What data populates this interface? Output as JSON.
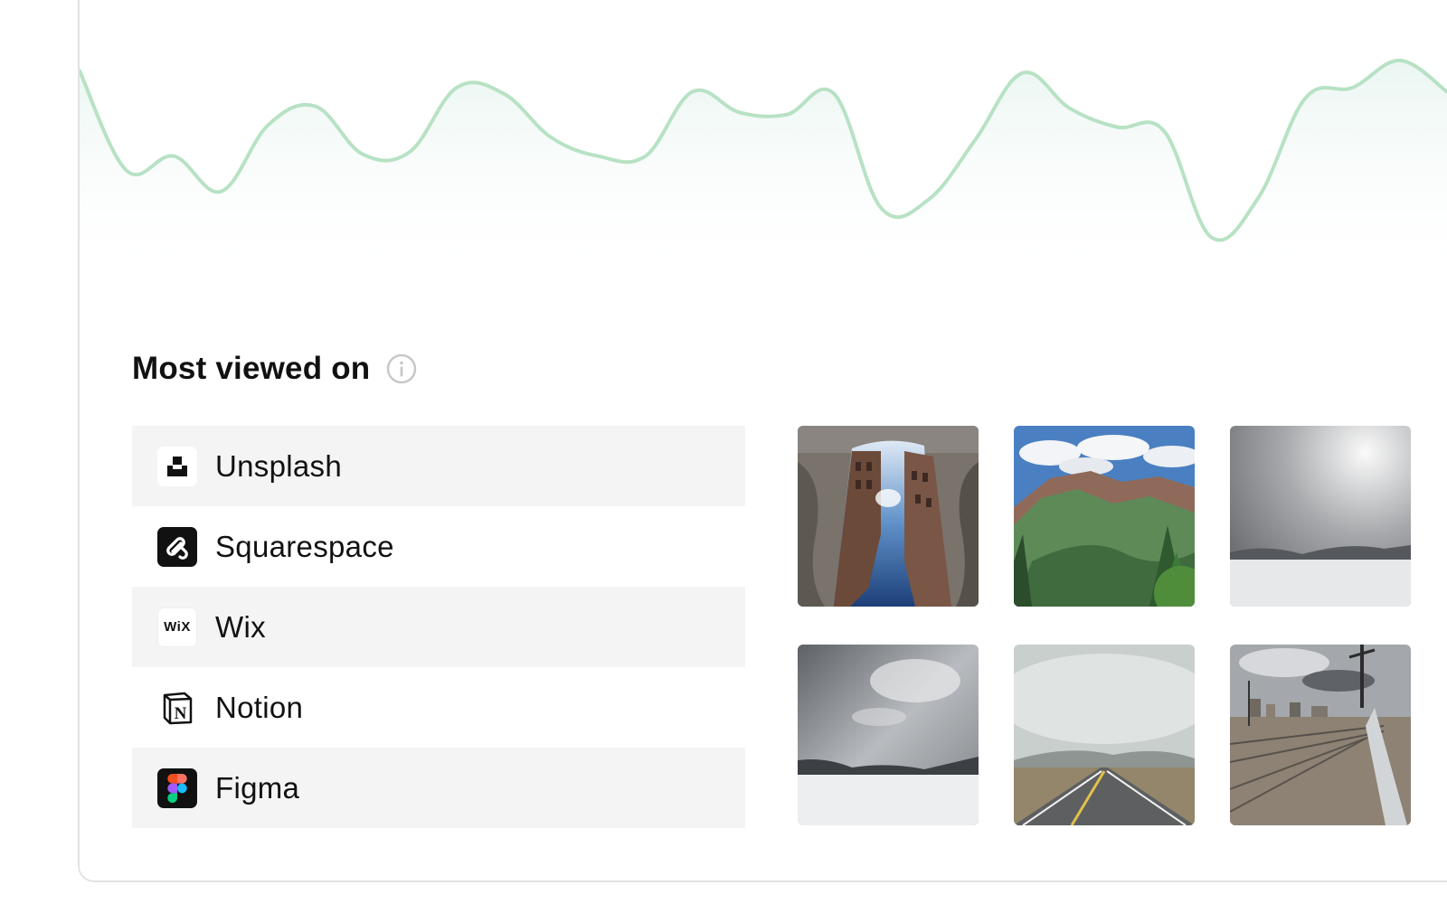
{
  "sparkline": {
    "color": "#b7e2c4",
    "values": [
      92,
      44,
      51,
      34,
      66,
      75,
      52,
      53,
      84,
      81,
      60,
      51,
      51,
      82,
      72,
      71,
      81,
      26,
      30,
      59,
      91,
      74,
      65,
      63,
      12,
      31,
      79,
      84,
      97,
      82
    ]
  },
  "most_viewed": {
    "title": "Most viewed on",
    "info_icon": "info-icon",
    "platforms": [
      {
        "name": "Unsplash",
        "icon": "unsplash-logo-icon"
      },
      {
        "name": "Squarespace",
        "icon": "squarespace-logo-icon"
      },
      {
        "name": "Wix",
        "icon": "wix-logo-icon",
        "logo_text": "WiX"
      },
      {
        "name": "Notion",
        "icon": "notion-logo-icon"
      },
      {
        "name": "Figma",
        "icon": "figma-logo-icon"
      }
    ]
  },
  "photos": [
    {
      "subject": "street-reflection-puddle"
    },
    {
      "subject": "mountain-valley-trees"
    },
    {
      "subject": "foggy-snowy-lake"
    },
    {
      "subject": "stormy-frozen-lake"
    },
    {
      "subject": "misty-highway"
    },
    {
      "subject": "railroad-tracks-city"
    }
  ]
}
